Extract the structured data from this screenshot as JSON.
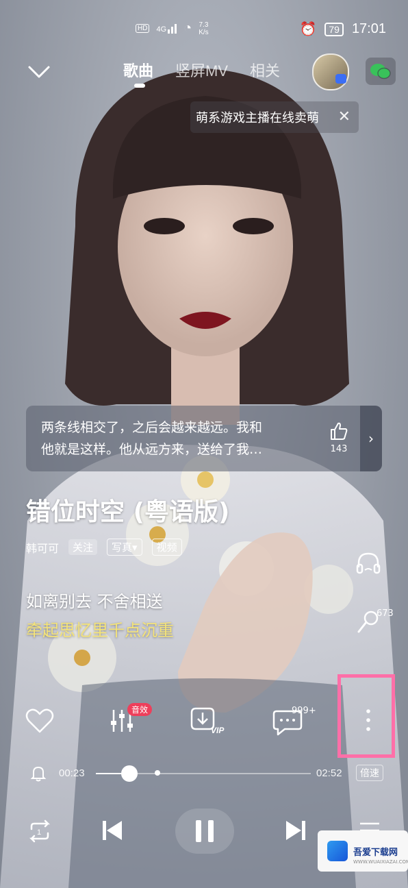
{
  "status_bar": {
    "hd": "HD",
    "signal": "4G",
    "speed_value": "7.3",
    "speed_unit": "K/s",
    "battery": "79",
    "time": "17:01"
  },
  "nav": {
    "tabs": [
      {
        "label": "歌曲"
      },
      {
        "label": "竖屏MV"
      },
      {
        "label": "相关"
      }
    ]
  },
  "promo": {
    "text": "萌系游戏主播在线卖萌",
    "close": "✕"
  },
  "comment": {
    "line1": "两条线相交了，之后会越来越远。我和",
    "line2": "他就是这样。他从远方来，送给了我…",
    "likes": "143"
  },
  "song": {
    "title": "错位时空 (粤语版)",
    "artist": "韩可可",
    "follow": "关注",
    "photo": "写真▾",
    "video": "视频"
  },
  "lyrics": {
    "previous": "如离别去 不舍相送",
    "current": "牵起思忆里千点沉重"
  },
  "side": {
    "mic_count": "673"
  },
  "actions": {
    "effect_badge": "音效",
    "comment_count": "999+",
    "vip": "VIP"
  },
  "progress": {
    "current": "00:23",
    "total": "02:52",
    "fraction": 0.155,
    "speed_label": "倍速"
  },
  "watermark": {
    "name": "吾爱下载网",
    "sub": "WWW.WUAIXIAZAI.COM"
  }
}
